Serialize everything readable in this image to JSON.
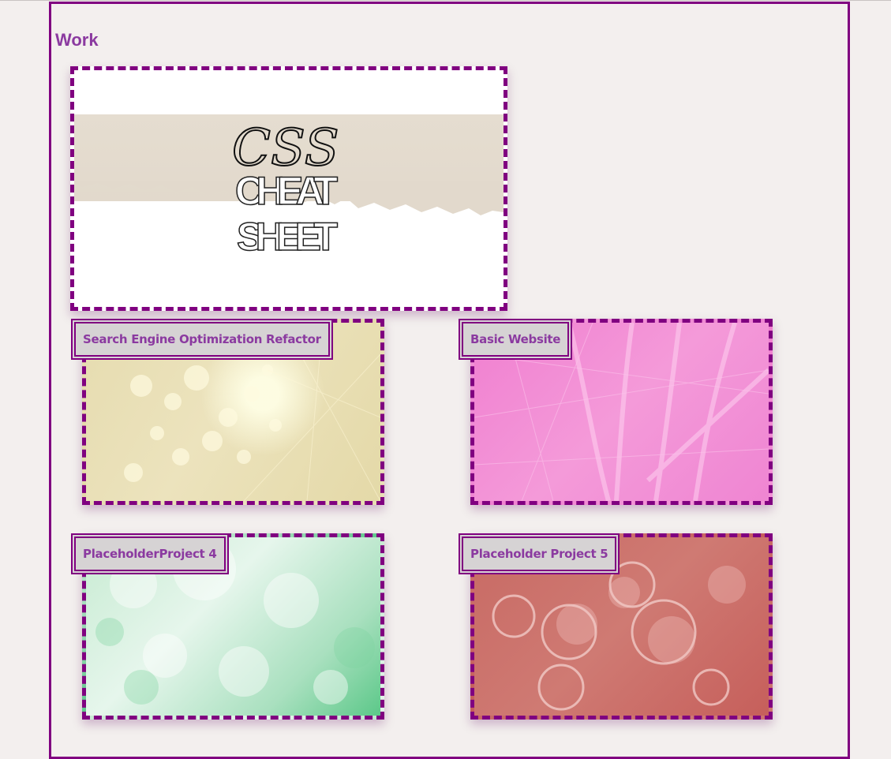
{
  "section": {
    "title": "Work"
  },
  "featured": {
    "art_text_line1": "CSS",
    "art_text_line2": "CHEAT",
    "art_text_line3": "SHEET"
  },
  "projects": [
    {
      "label": "Search Engine Optimization Refactor"
    },
    {
      "label": "Basic Website"
    },
    {
      "label": "PlaceholderProject 4"
    },
    {
      "label": "Placeholder Project 5"
    }
  ],
  "colors": {
    "accent": "#800080",
    "heading": "#8b3aa0",
    "background": "#f3efee",
    "label_bg": "#d6d3d4"
  }
}
